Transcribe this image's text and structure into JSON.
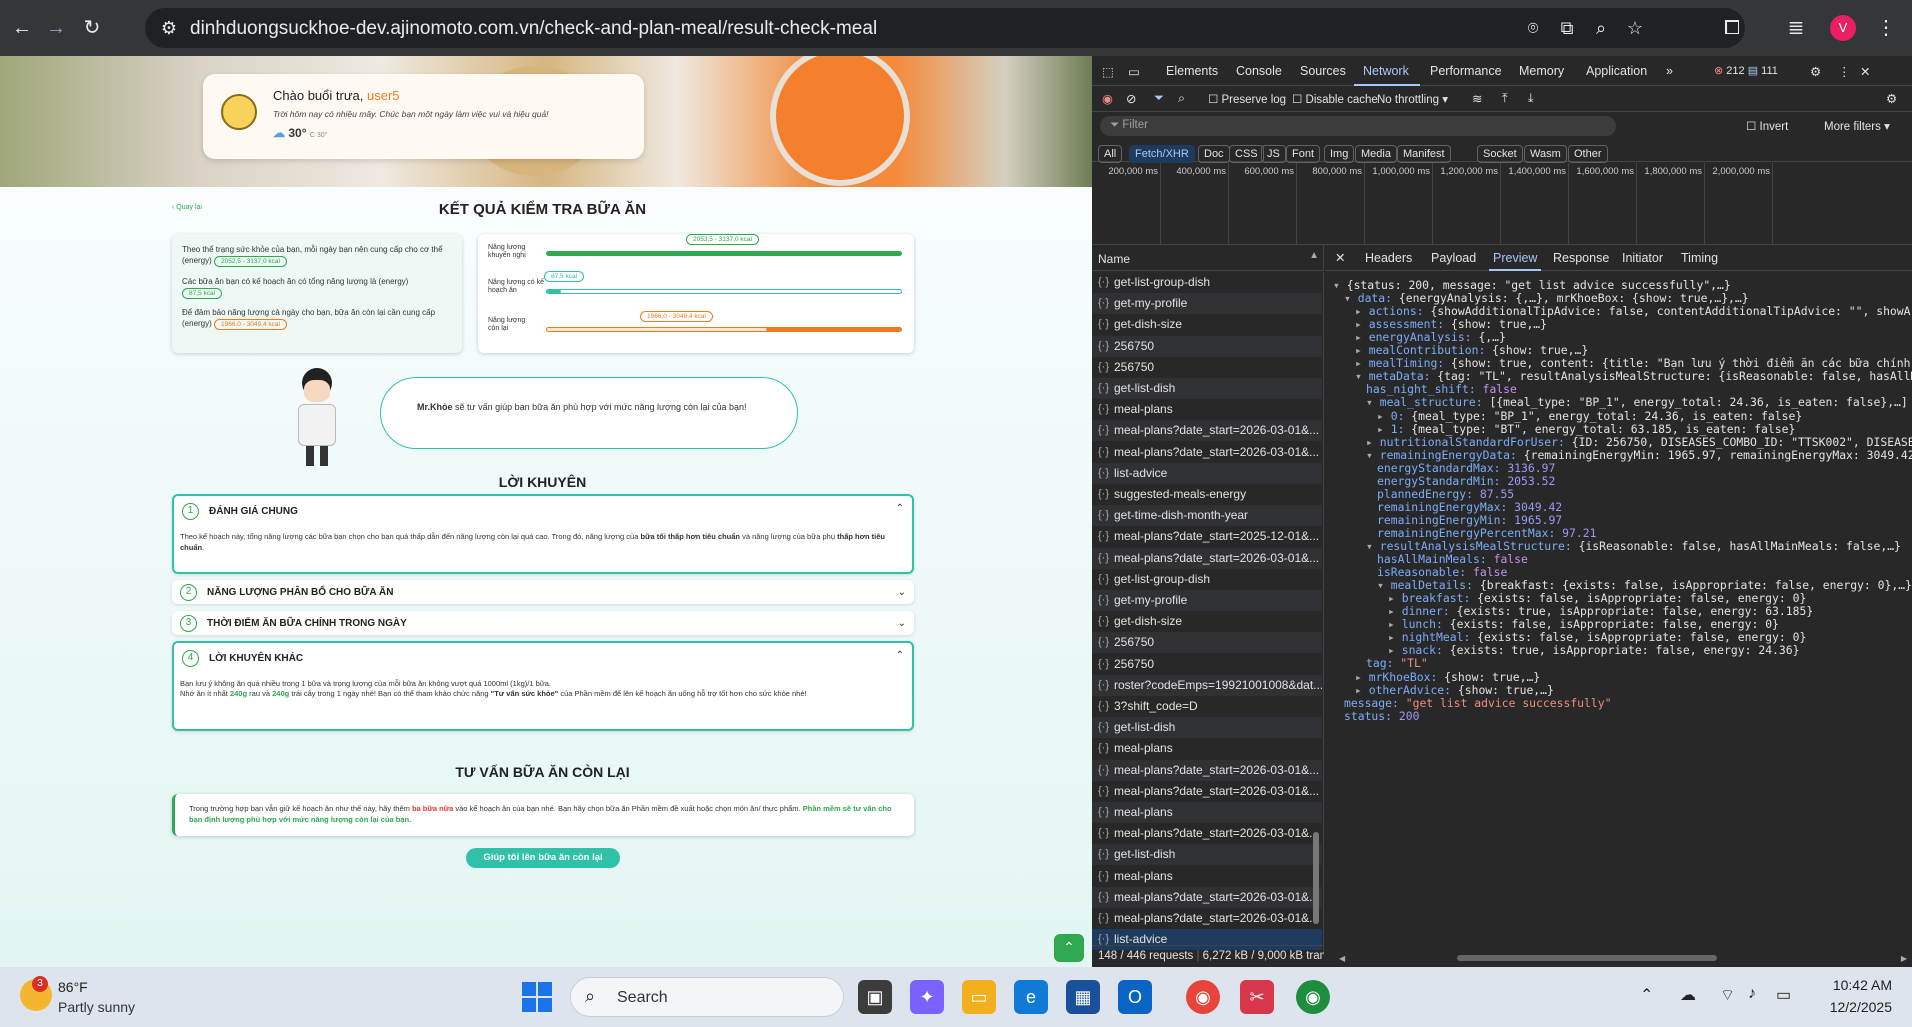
{
  "browser": {
    "url": "dinhduongsuckhoe-dev.ajinomoto.com.vn/check-and-plan-meal/result-check-meal",
    "profile_initial": "V"
  },
  "page": {
    "greeting": {
      "hello": "Chào buổi trưa,",
      "user": "user5",
      "weather_text": "Trời hôm nay có nhiều mây. Chúc bạn một ngày làm việc vui và hiệu quả!",
      "temperature": "30°",
      "temp_small": "C 30°"
    },
    "back_label": "Quay lại",
    "title": "KẾT QUẢ KIỂM TRA BỮA ĂN",
    "summary": {
      "line1": "Theo thể trạng sức khỏe của bạn, mỗi ngày bạn nên cung cấp cho cơ thể (energy)",
      "pill1": "2052,5 - 3137,0 kcal",
      "line2": "Các bữa ăn bạn có kế hoạch ăn có tổng năng lượng là (energy)",
      "pill2": "87,5 kcal",
      "line3": "Để đảm bảo năng lượng cả ngày cho bạn, bữa ăn còn lại cần cung cấp (energy)",
      "pill3": "1966,0 - 3049,4 kcal"
    },
    "energy_bars": [
      {
        "label": "Năng lượng khuyến nghị",
        "range": "2053,5 - 3137,0 kcal",
        "fill": 1.0
      },
      {
        "label": "Năng lượng có kế hoạch ăn",
        "range": "87,5 kcal",
        "fill": 0.04
      },
      {
        "label": "Năng lượng còn lại",
        "range": "1966,0 - 3049,4 kcal",
        "fill": 0.38
      }
    ],
    "mrkhoe": {
      "name": "Mr.Khỏe",
      "text": "sẽ tư vấn giúp bạn bữa ăn phù hợp với mức năng lượng còn lại của bạn!"
    },
    "advice_title": "LỜI KHUYÊN",
    "accordions": [
      {
        "num": "1",
        "title": "ĐÁNH GIÁ CHUNG",
        "body_a": "Theo kế hoạch này, tổng năng lượng các bữa bạn chọn cho bạn quá thấp dẫn đến năng lượng còn lại quá cao. Trong đó, năng lượng của",
        "body_b": "bữa tối thấp hơn tiêu chuẩn",
        "body_c": "và năng lượng của bữa phụ",
        "body_d": "thấp hơn tiêu chuẩn",
        "body_e": "."
      },
      {
        "num": "2",
        "title": "NĂNG LƯỢNG PHÂN BỔ CHO BỮA ĂN"
      },
      {
        "num": "3",
        "title": "THỜI ĐIỂM ĂN BỮA CHÍNH TRONG NGÀY"
      },
      {
        "num": "4",
        "title": "LỜI KHUYÊN KHÁC",
        "body_1": "Bạn lưu ý không ăn quá nhiều trong 1 bữa và trọng lượng của mỗi bữa ăn không vượt quá 1000ml (1kg)/1 bữa.",
        "body_2a": "Nhớ ăn ít nhất",
        "body_2b": "240g",
        "body_2c": "rau và",
        "body_2d": "240g",
        "body_2e": "trái cây trong 1 ngày nhé! Bạn có thể tham khảo chức năng",
        "body_2f": "\"Tư vấn sức khỏe\"",
        "body_2g": "của Phần mềm để lên kế hoạch ăn uống hỗ trợ tốt hơn cho sức khỏe nhé!"
      }
    ],
    "remaining_title": "TƯ VẤN BỮA ĂN CÒN LẠI",
    "remaining_a": "Trong trường hợp bạn vẫn giữ kế hoạch ăn như thế này, hãy thêm",
    "remaining_b": "ba bữa nữa",
    "remaining_c": "vào kế hoạch ăn của bạn nhé. Bạn hãy chọn bữa ăn Phần mềm đề xuất hoặc chọn món ăn/ thực phẩm.",
    "remaining_d": "Phần mềm sẽ tư vấn cho bạn định lượng phù hợp với mức năng lượng còn lại của bạn.",
    "cta": "Giúp tôi lên bữa ăn còn lại"
  },
  "devtools": {
    "tabs": [
      "Elements",
      "Console",
      "Sources",
      "Network",
      "Performance",
      "Memory",
      "Application"
    ],
    "errors": "212",
    "warnings": "111",
    "preserve_log": "Preserve log",
    "disable_cache": "Disable cache",
    "throttling": "No throttling",
    "filter_placeholder": "Filter",
    "invert": "Invert",
    "more_filters": "More filters",
    "type_filters": [
      "All",
      "Fetch/XHR",
      "Doc",
      "CSS",
      "JS",
      "Font",
      "Img",
      "Media",
      "Manifest",
      "Socket",
      "Wasm",
      "Other"
    ],
    "timeline_ticks": [
      "200,000 ms",
      "400,000 ms",
      "600,000 ms",
      "800,000 ms",
      "1,000,000 ms",
      "1,200,000 ms",
      "1,400,000 ms",
      "1,600,000 ms",
      "1,800,000 ms",
      "2,000,000 ms"
    ],
    "name_header": "Name",
    "requests": [
      "get-list-group-dish",
      "get-my-profile",
      "get-dish-size",
      "256750",
      "256750",
      "get-list-dish",
      "meal-plans",
      "meal-plans?date_start=2026-03-01&...",
      "meal-plans?date_start=2026-03-01&...",
      "list-advice",
      "suggested-meals-energy",
      "get-time-dish-month-year",
      "meal-plans?date_start=2025-12-01&...",
      "meal-plans?date_start=2026-03-01&...",
      "get-list-group-dish",
      "get-my-profile",
      "get-dish-size",
      "256750",
      "256750",
      "roster?codeEmps=19921001008&dat...",
      "3?shift_code=D",
      "get-list-dish",
      "meal-plans",
      "meal-plans?date_start=2026-03-01&...",
      "meal-plans?date_start=2026-03-01&...",
      "meal-plans",
      "meal-plans?date_start=2026-03-01&...",
      "get-list-dish",
      "meal-plans",
      "meal-plans?date_start=2026-03-01&...",
      "meal-plans?date_start=2026-03-01&...",
      "list-advice"
    ],
    "detail_tabs": [
      "Headers",
      "Payload",
      "Preview",
      "Response",
      "Initiator",
      "Timing"
    ],
    "status_requests": "148 / 446 requests",
    "status_size": "6,272 kB / 9,000 kB tran",
    "preview": [
      {
        "i": 0,
        "a": "▾",
        "k": "",
        "v": "{status: 200, message: \"get list advice successfully\",…}",
        "c": "g"
      },
      {
        "i": 1,
        "a": "▾",
        "k": "data",
        "v": "{energyAnalysis: {,…}, mrKhoeBox: {show: true,…},…}",
        "c": "g"
      },
      {
        "i": 2,
        "a": "▸",
        "k": "actions",
        "v": "{showAdditionalTipAdvice: false, contentAdditionalTipAdvice: \"\", showA",
        "c": "g"
      },
      {
        "i": 2,
        "a": "▸",
        "k": "assessment",
        "v": "{show: true,…}",
        "c": "g"
      },
      {
        "i": 2,
        "a": "▸",
        "k": "energyAnalysis",
        "v": "{,…}",
        "c": "g"
      },
      {
        "i": 2,
        "a": "▸",
        "k": "mealContribution",
        "v": "{show: true,…}",
        "c": "g"
      },
      {
        "i": 2,
        "a": "▸",
        "k": "mealTiming",
        "v": "{show: true, content: {title: \"Bạn lưu ý thời điểm ăn các bữa chính",
        "c": "g"
      },
      {
        "i": 2,
        "a": "▾",
        "k": "metaData",
        "v": "{tag: \"TL\", resultAnalysisMealStructure: {isReasonable: false, hasAllM",
        "c": "g"
      },
      {
        "i": 3,
        "a": "",
        "k": "has_night_shift",
        "v": "false",
        "c": "b"
      },
      {
        "i": 3,
        "a": "▾",
        "k": "meal_structure",
        "v": "[{meal_type: \"BP_1\", energy_total: 24.36, is_eaten: false},…]",
        "c": "g"
      },
      {
        "i": 4,
        "a": "▸",
        "k": "0",
        "v": "{meal_type: \"BP_1\", energy_total: 24.36, is_eaten: false}",
        "c": "g"
      },
      {
        "i": 4,
        "a": "▸",
        "k": "1",
        "v": "{meal_type: \"BT\", energy_total: 63.185, is_eaten: false}",
        "c": "g"
      },
      {
        "i": 3,
        "a": "▸",
        "k": "nutritionalStandardForUser",
        "v": "{ID: 256750, DISEASES_COMBO_ID: \"TTSK002\", DISEASE",
        "c": "g"
      },
      {
        "i": 3,
        "a": "▾",
        "k": "remainingEnergyData",
        "v": "{remainingEnergyMin: 1965.97, remainingEnergyMax: 3049.42",
        "c": "g"
      },
      {
        "i": 4,
        "a": "",
        "k": "energyStandardMax",
        "v": "3136.97",
        "c": "n"
      },
      {
        "i": 4,
        "a": "",
        "k": "energyStandardMin",
        "v": "2053.52",
        "c": "n"
      },
      {
        "i": 4,
        "a": "",
        "k": "plannedEnergy",
        "v": "87.55",
        "c": "n"
      },
      {
        "i": 4,
        "a": "",
        "k": "remainingEnergyMax",
        "v": "3049.42",
        "c": "n"
      },
      {
        "i": 4,
        "a": "",
        "k": "remainingEnergyMin",
        "v": "1965.97",
        "c": "n"
      },
      {
        "i": 4,
        "a": "",
        "k": "remainingEnergyPercentMax",
        "v": "97.21",
        "c": "n"
      },
      {
        "i": 3,
        "a": "▾",
        "k": "resultAnalysisMealStructure",
        "v": "{isReasonable: false, hasAllMainMeals: false,…}",
        "c": "g"
      },
      {
        "i": 4,
        "a": "",
        "k": "hasAllMainMeals",
        "v": "false",
        "c": "b"
      },
      {
        "i": 4,
        "a": "",
        "k": "isReasonable",
        "v": "false",
        "c": "b"
      },
      {
        "i": 4,
        "a": "▾",
        "k": "mealDetails",
        "v": "{breakfast: {exists: false, isAppropriate: false, energy: 0},…}",
        "c": "g"
      },
      {
        "i": 5,
        "a": "▸",
        "k": "breakfast",
        "v": "{exists: false, isAppropriate: false, energy: 0}",
        "c": "g"
      },
      {
        "i": 5,
        "a": "▸",
        "k": "dinner",
        "v": "{exists: true, isAppropriate: false, energy: 63.185}",
        "c": "g"
      },
      {
        "i": 5,
        "a": "▸",
        "k": "lunch",
        "v": "{exists: false, isAppropriate: false, energy: 0}",
        "c": "g"
      },
      {
        "i": 5,
        "a": "▸",
        "k": "nightMeal",
        "v": "{exists: false, isAppropriate: false, energy: 0}",
        "c": "g"
      },
      {
        "i": 5,
        "a": "▸",
        "k": "snack",
        "v": "{exists: true, isAppropriate: false, energy: 24.36}",
        "c": "g"
      },
      {
        "i": 3,
        "a": "",
        "k": "tag",
        "v": "\"TL\"",
        "c": "s"
      },
      {
        "i": 2,
        "a": "▸",
        "k": "mrKhoeBox",
        "v": "{show: true,…}",
        "c": "g"
      },
      {
        "i": 2,
        "a": "▸",
        "k": "otherAdvice",
        "v": "{show: true,…}",
        "c": "g"
      },
      {
        "i": 1,
        "a": "",
        "k": "message",
        "v": "\"get list advice successfully\"",
        "c": "s"
      },
      {
        "i": 1,
        "a": "",
        "k": "status",
        "v": "200",
        "c": "n"
      }
    ]
  },
  "taskbar": {
    "weather_temp": "86°F",
    "weather_desc": "Partly sunny",
    "weather_badge": "3",
    "search": "Search",
    "time": "10:42 AM",
    "date": "12/2/2025"
  }
}
